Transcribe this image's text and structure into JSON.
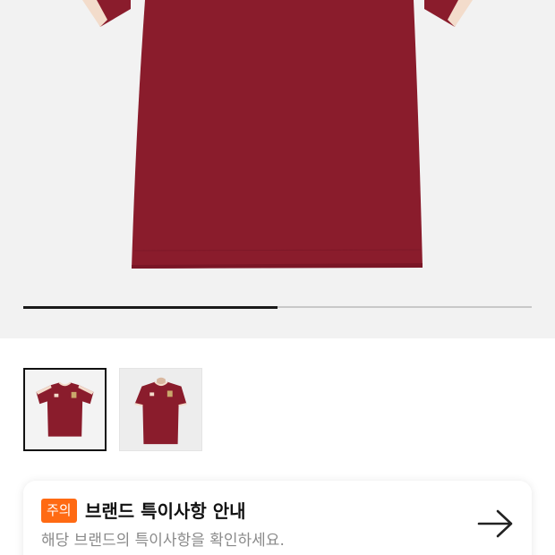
{
  "gallery": {
    "main_image": "burgundy-tshirt-photo",
    "slide_progress": 0.5
  },
  "thumbnails": [
    {
      "image": "burgundy-tshirt-front-thumbnail",
      "selected": true
    },
    {
      "image": "burgundy-tshirt-model-thumbnail",
      "selected": false
    }
  ],
  "notice": {
    "badge": "주의",
    "title": "브랜드 특이사항 안내",
    "subtitle": "해당 브랜드의 특이사항을 확인하세요.",
    "arrow_icon": "arrow-right-icon"
  },
  "colors": {
    "shirt": "#8a1c2c",
    "trim": "#f3dccb",
    "badge": "#ff6a13",
    "gallery_bg": "#f2f2f2"
  }
}
